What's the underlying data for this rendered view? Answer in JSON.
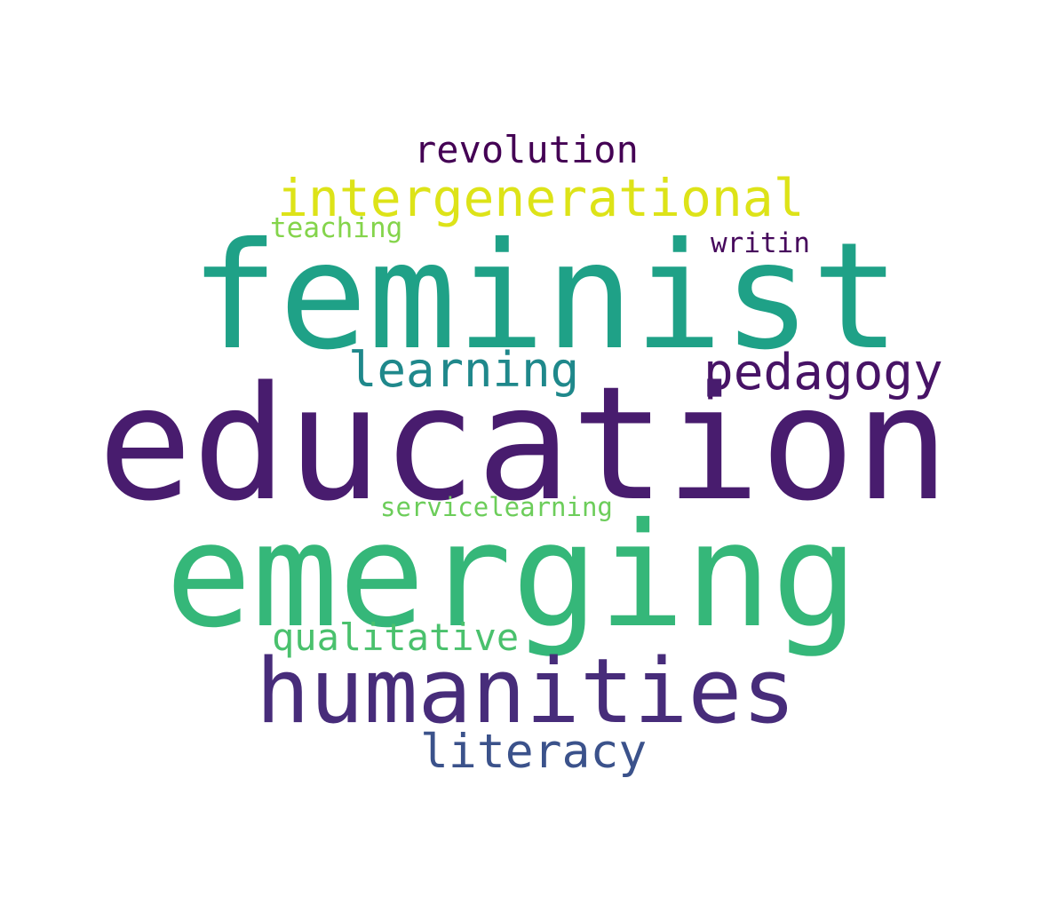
{
  "words": [
    {
      "id": "w-revolution",
      "text": "revolution",
      "color": "#440154"
    },
    {
      "id": "w-intergen",
      "text": "intergenerational",
      "color": "#dde318"
    },
    {
      "id": "w-teaching",
      "text": "teaching",
      "color": "#84d44b"
    },
    {
      "id": "w-writin",
      "text": "writin",
      "color": "#46085c"
    },
    {
      "id": "w-feminist",
      "text": "feminist",
      "color": "#1fa187"
    },
    {
      "id": "w-learning",
      "text": "learning",
      "color": "#1f888b"
    },
    {
      "id": "w-pedagogy",
      "text": "pedagogy",
      "color": "#471366"
    },
    {
      "id": "w-education",
      "text": "education",
      "color": "#481c6e"
    },
    {
      "id": "w-service",
      "text": "servicelearning",
      "color": "#6ccd5a"
    },
    {
      "id": "w-emerging",
      "text": "emerging",
      "color": "#35b779"
    },
    {
      "id": "w-qualitative",
      "text": "qualitative",
      "color": "#4ac16d"
    },
    {
      "id": "w-humanities",
      "text": "humanities",
      "color": "#472c7a"
    },
    {
      "id": "w-literacy",
      "text": "literacy",
      "color": "#3b528b"
    }
  ]
}
